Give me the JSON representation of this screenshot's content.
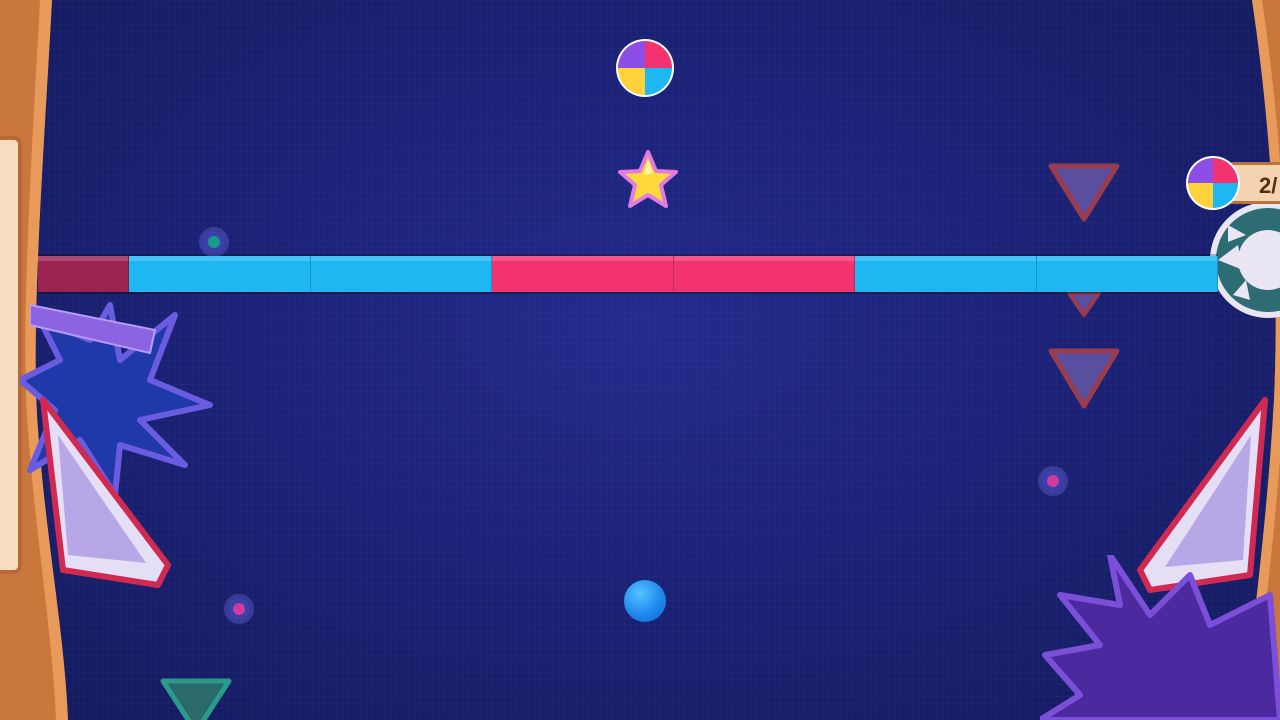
{
  "hud": {
    "color_wheel_counter": "2/"
  },
  "colors": {
    "cyan": "#1fb7f2",
    "pink": "#f2336f",
    "dark_pink": "#9b2352",
    "player_ball": "#1e88ee",
    "star": "#ffd93b",
    "frame_wood": "#c9773d"
  },
  "color_bar": {
    "segments": [
      "dark_pink",
      "cyan",
      "cyan",
      "pink",
      "pink",
      "cyan",
      "cyan"
    ]
  },
  "icons": {
    "color_wheel": "color-wheel-icon",
    "star": "star-icon",
    "player": "player-ball-icon",
    "spike": "triangle-spike-icon"
  }
}
